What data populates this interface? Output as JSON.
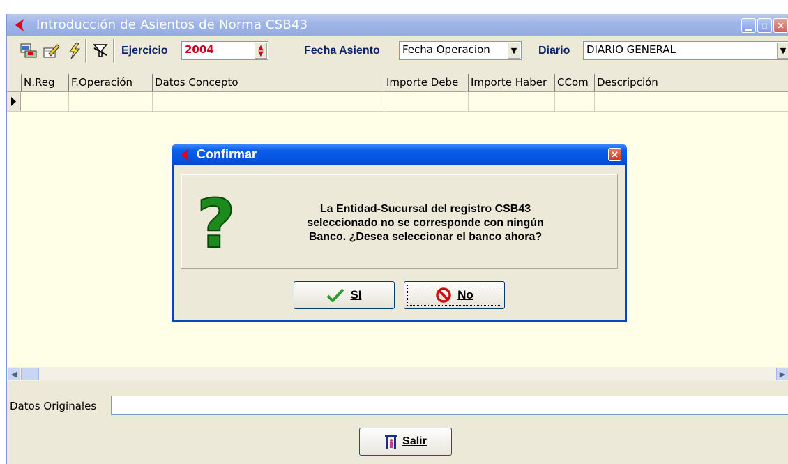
{
  "window": {
    "title": "Introducción de Asientos de Norma CSB43",
    "controls": [
      "minimize",
      "maximize",
      "close"
    ]
  },
  "toolbar": {
    "icons": [
      "print-icon",
      "edit-icon",
      "lightning-icon",
      "filter-clear-icon"
    ],
    "ejercicio_label": "Ejercicio",
    "ejercicio_value": "2004",
    "fecha_asiento_label": "Fecha Asiento",
    "fecha_asiento_value": "Fecha Operacion",
    "diario_label": "Diario",
    "diario_value": "DIARIO GENERAL"
  },
  "grid": {
    "columns": [
      "N.Reg",
      "F.Operación",
      "Datos Concepto",
      "Importe Debe",
      "Importe Haber",
      "CCom",
      "Descripción"
    ],
    "rows": [
      [
        "",
        "",
        "",
        "",
        "",
        "",
        ""
      ]
    ]
  },
  "bottom": {
    "datos_originales_label": "Datos Originales",
    "datos_originales_value": "",
    "salir_label": "Salir"
  },
  "dialog": {
    "title": "Confirmar",
    "message_line1": "La Entidad-Sucursal del registro CSB43",
    "message_line2": "seleccionado no se corresponde con ningún",
    "message_line3": "Banco. ¿Desea seleccionar el banco ahora?",
    "yes_label": "SI",
    "no_label": "No"
  },
  "colors": {
    "grid_background": "#fffee6",
    "dialog_title": "#0554e3",
    "window_title": "#9fb4e6",
    "accent_red": "#e2001a"
  }
}
